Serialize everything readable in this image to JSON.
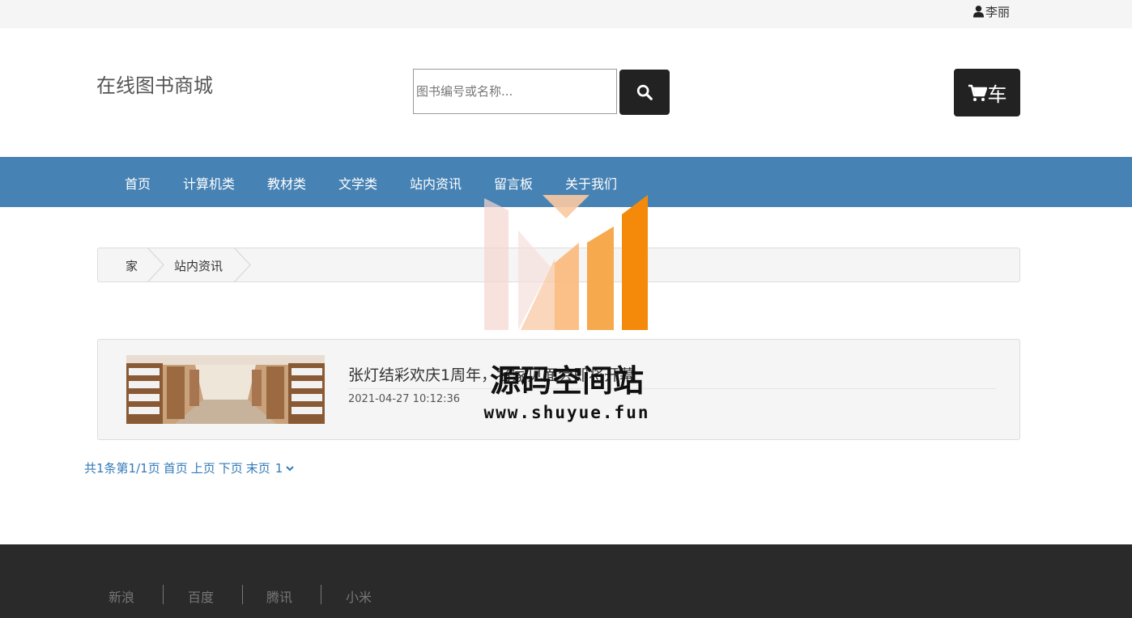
{
  "topbar": {
    "username": "李丽"
  },
  "header": {
    "site_title": "在线图书商城",
    "search_placeholder": "图书编号或名称...",
    "cart_label": "车"
  },
  "nav": {
    "items": [
      {
        "label": "首页"
      },
      {
        "label": "计算机类"
      },
      {
        "label": "教材类"
      },
      {
        "label": "文学类"
      },
      {
        "label": "站内资讯"
      },
      {
        "label": "留言板"
      },
      {
        "label": "关于我们"
      }
    ]
  },
  "breadcrumb": {
    "items": [
      {
        "label": "家"
      },
      {
        "label": "站内资讯"
      }
    ]
  },
  "article": {
    "title": "张灯结彩欢庆1周年，名家见面会即将开幕",
    "date": "2021-04-27 10:12:36"
  },
  "pager": {
    "total": "共1条",
    "page_info": "第1/1页",
    "first": "首页",
    "prev": "上页",
    "next": "下页",
    "last": "末页",
    "current_option": "1"
  },
  "footer": {
    "links": [
      {
        "label": "新浪"
      },
      {
        "label": "百度"
      },
      {
        "label": "腾讯"
      },
      {
        "label": "小米"
      }
    ]
  },
  "watermark": {
    "title": "源码空间站",
    "url": "www.shuyue.fun"
  },
  "colors": {
    "nav_bg": "#4682b4",
    "dark_button": "#222222",
    "footer_bg": "#2a2a2a",
    "link": "#337ab7"
  }
}
